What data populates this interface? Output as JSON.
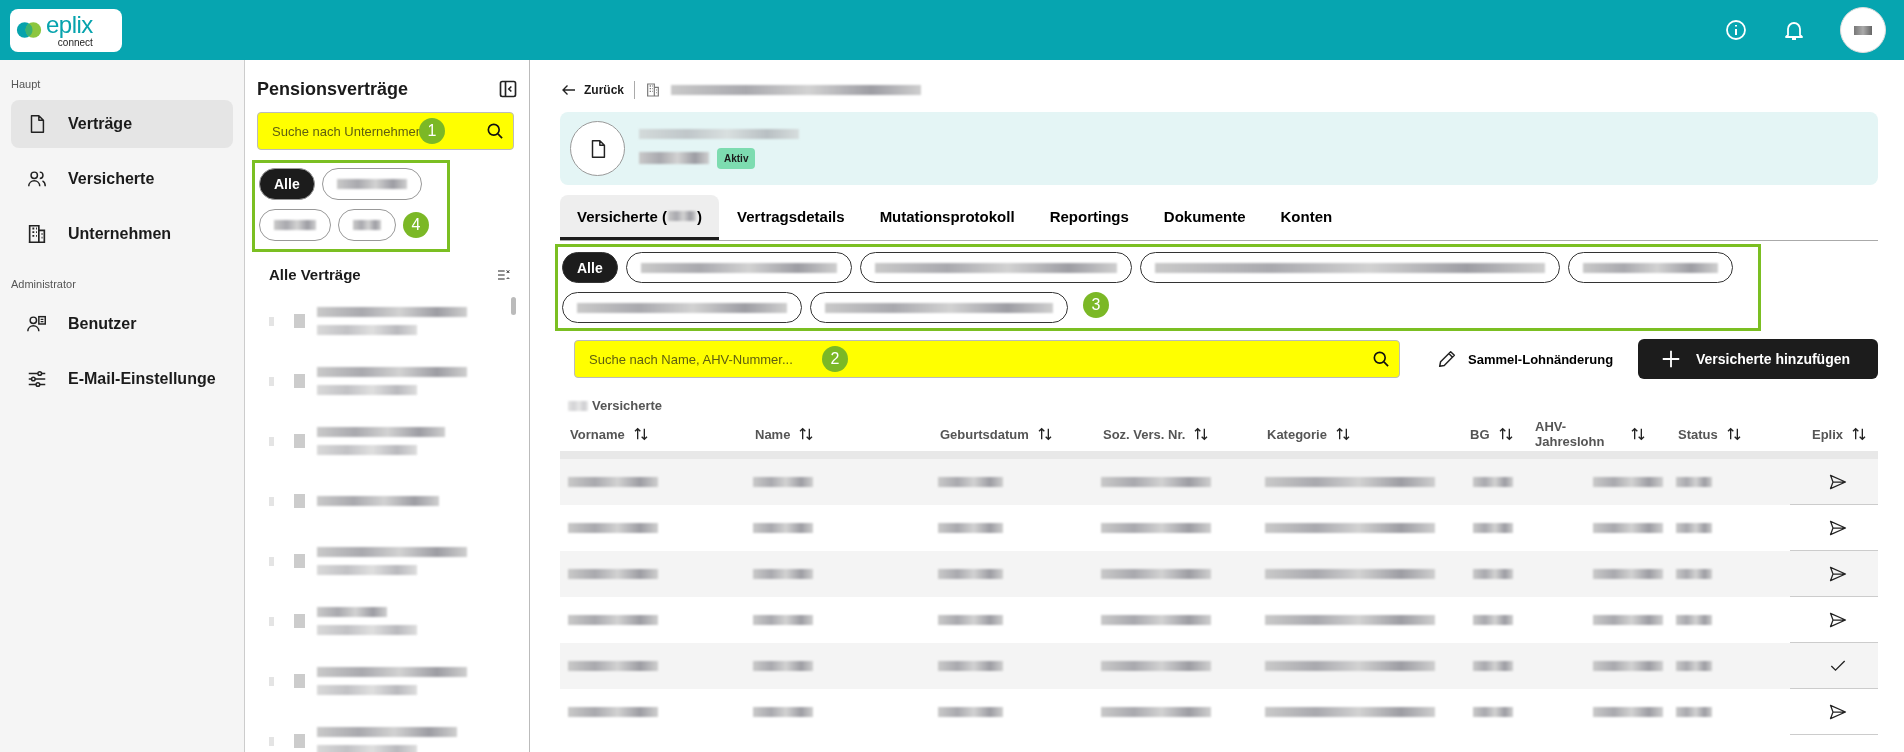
{
  "header": {
    "logo": {
      "word": "eplix",
      "sub": "connect"
    }
  },
  "sidebar": {
    "sections": [
      {
        "title": "Haupt",
        "items": [
          {
            "label": "Verträge",
            "selected": true
          },
          {
            "label": "Versicherte",
            "selected": false
          },
          {
            "label": "Unternehmen",
            "selected": false
          }
        ]
      },
      {
        "title": "Administrator",
        "items": [
          {
            "label": "Benutzer",
            "selected": false
          },
          {
            "label": "E-Mail-Einstellunge",
            "selected": false
          }
        ]
      }
    ]
  },
  "contracts_panel": {
    "title": "Pensionsverträge",
    "search": {
      "placeholder": "Suche nach Unternehmen",
      "highlighted": true,
      "marker": "1"
    },
    "filters": {
      "framed": true,
      "marker": "4",
      "chips": [
        {
          "label": "Alle",
          "selected": true
        },
        {
          "kind": "redacted",
          "selected": false
        },
        {
          "kind": "redacted",
          "selected": false
        },
        {
          "kind": "redacted",
          "selected": false
        }
      ]
    },
    "list_title": "Alle Verträge",
    "items": [
      {
        "kind": "redacted"
      },
      {
        "kind": "redacted"
      },
      {
        "kind": "redacted"
      },
      {
        "kind": "redacted"
      },
      {
        "kind": "redacted"
      },
      {
        "kind": "redacted"
      },
      {
        "kind": "redacted"
      },
      {
        "kind": "redacted"
      }
    ]
  },
  "main": {
    "back": "Zurück",
    "contract": {
      "badge": "Aktiv"
    },
    "tabs": [
      {
        "label_before": "Versicherte (",
        "label_after": ")",
        "selected": true
      },
      {
        "label": "Vertragsdetails",
        "selected": false
      },
      {
        "label": "Mutationsprotokoll",
        "selected": false
      },
      {
        "label": "Reportings",
        "selected": false
      },
      {
        "label": "Dokumente",
        "selected": false
      },
      {
        "label": "Konten",
        "selected": false
      }
    ],
    "categories": {
      "framed": true,
      "marker": "3",
      "chips": [
        {
          "label": "Alle",
          "selected": true
        },
        {
          "kind": "redacted",
          "selected": false
        },
        {
          "kind": "redacted",
          "selected": false
        },
        {
          "kind": "redacted",
          "selected": false
        },
        {
          "kind": "redacted",
          "selected": false
        },
        {
          "kind": "redacted",
          "selected": false
        },
        {
          "kind": "redacted",
          "selected": false
        }
      ]
    },
    "search": {
      "placeholder": "Suche nach Name, AHV-Nummer...",
      "highlighted": true,
      "marker": "2"
    },
    "bulk_action": "Sammel-Lohnänderung",
    "add_button": "Versicherte hinzufügen",
    "count_label": "Versicherte",
    "table": {
      "columns": [
        {
          "label": "Vorname",
          "sortable": true
        },
        {
          "label": "Name",
          "sortable": true
        },
        {
          "label": "Geburtsdatum",
          "sortable": true
        },
        {
          "label": "Soz. Vers. Nr.",
          "sortable": true
        },
        {
          "label": "Kategorie",
          "sortable": true
        },
        {
          "label": "BG",
          "sortable": true
        },
        {
          "label": "AHV-Jahreslohn",
          "sortable": true
        },
        {
          "label": "Status",
          "sortable": true
        },
        {
          "label": "Eplix",
          "sortable": true
        }
      ],
      "rows": [
        {
          "kind": "send"
        },
        {
          "kind": "send"
        },
        {
          "kind": "send"
        },
        {
          "kind": "send"
        },
        {
          "kind": "done"
        },
        {
          "kind": "send"
        }
      ]
    }
  }
}
